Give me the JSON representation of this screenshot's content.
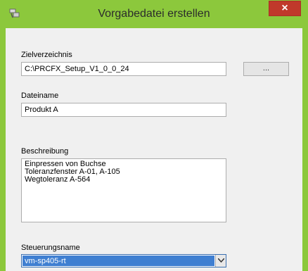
{
  "window": {
    "title": "Vorgabedatei erstellen",
    "close_label": "×"
  },
  "form": {
    "target_dir": {
      "label": "Zielverzeichnis",
      "value": "C:\\PRCFX_Setup_V1_0_0_24",
      "browse_label": "..."
    },
    "filename": {
      "label": "Dateiname",
      "value": "Produkt A"
    },
    "description": {
      "label": "Beschreibung",
      "lines": [
        "Einpressen von Buchse",
        "Toleranzfenster A-01, A-105",
        "Wegtoleranz A-564"
      ]
    },
    "controller": {
      "label": "Steuerungsname",
      "selected": "vm-sp405-rt"
    }
  },
  "colors": {
    "titlebar": "#8cc83c",
    "close_button": "#c0392b",
    "selection": "#3f7fd1"
  }
}
